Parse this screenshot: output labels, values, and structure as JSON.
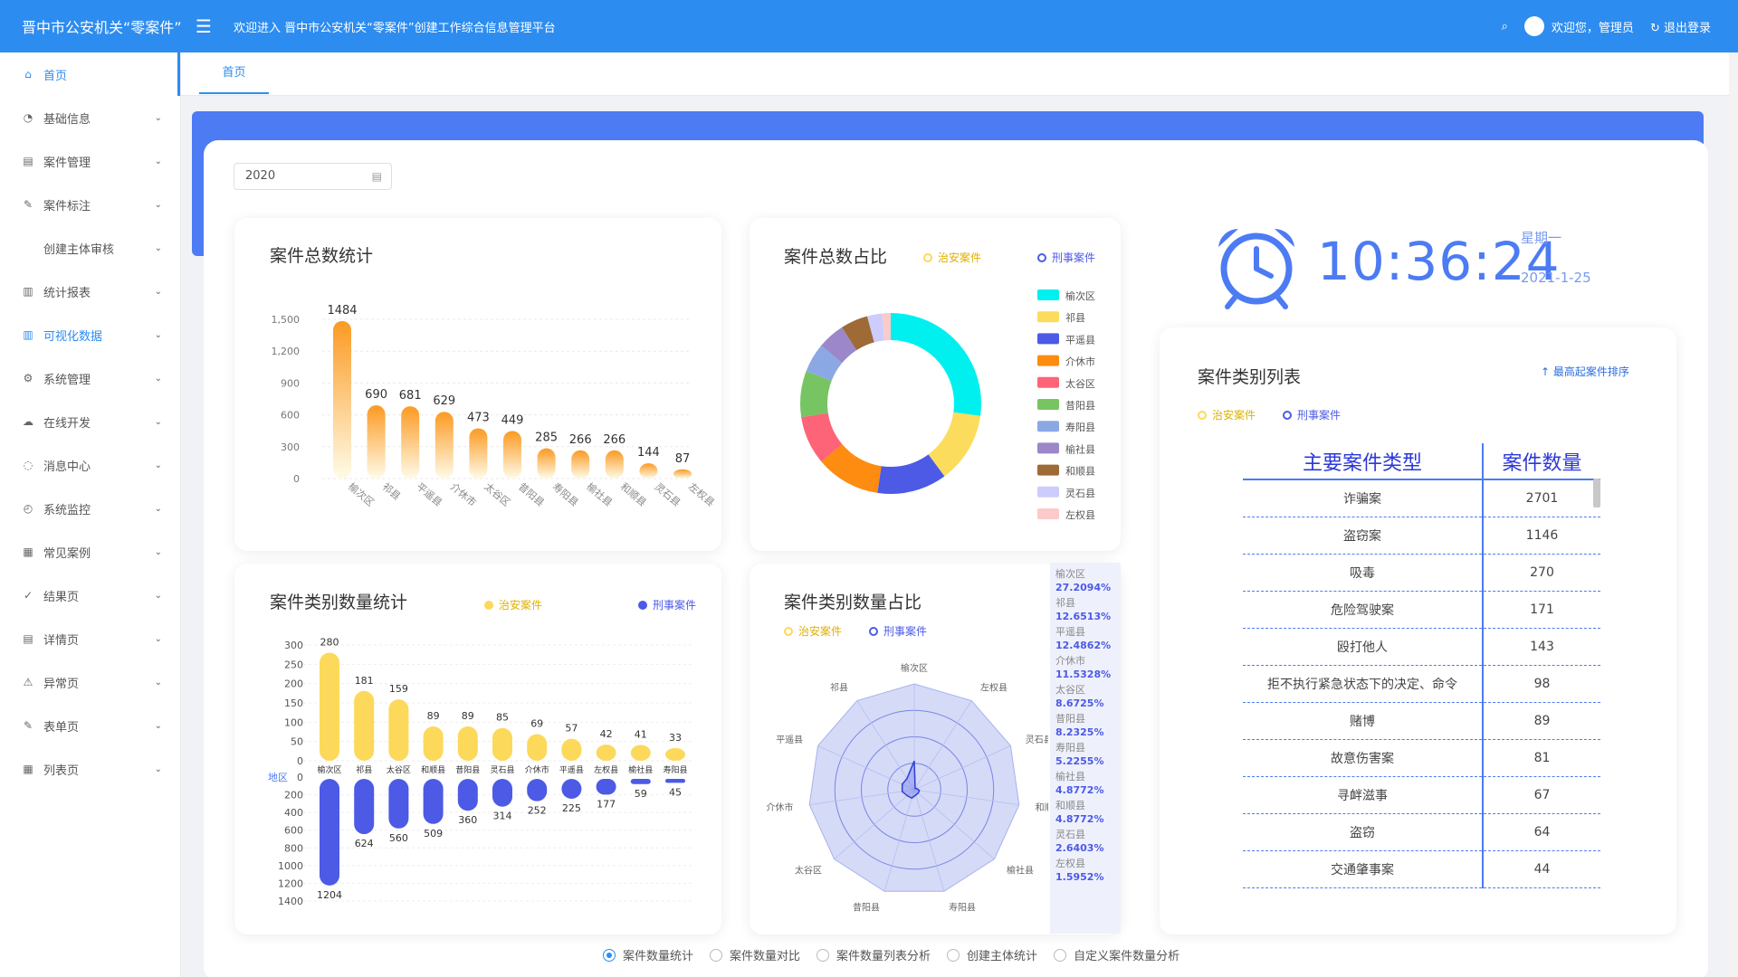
{
  "header": {
    "brand": "晋中市公安机关“零案件”",
    "welcome": "欢迎进入 晋中市公安机关“零案件”创建工作综合信息管理平台",
    "user": "欢迎您，管理员",
    "logout": "退出登录",
    "search_icon": "search-icon"
  },
  "sidebar": {
    "items": [
      {
        "label": "首页",
        "icon": "⌂"
      },
      {
        "label": "基础信息",
        "icon": "◔"
      },
      {
        "label": "案件管理",
        "icon": "▤"
      },
      {
        "label": "案件标注",
        "icon": "✎"
      },
      {
        "label": "创建主体审核",
        "icon": ""
      },
      {
        "label": "统计报表",
        "icon": "▥"
      },
      {
        "label": "可视化数据",
        "icon": "▥"
      },
      {
        "label": "系统管理",
        "icon": "⚙"
      },
      {
        "label": "在线开发",
        "icon": "☁"
      },
      {
        "label": "消息中心",
        "icon": "◌"
      },
      {
        "label": "系统监控",
        "icon": "◴"
      },
      {
        "label": "常见案例",
        "icon": "▦"
      },
      {
        "label": "结果页",
        "icon": "✓"
      },
      {
        "label": "详情页",
        "icon": "▤"
      },
      {
        "label": "异常页",
        "icon": "⚠"
      },
      {
        "label": "表单页",
        "icon": "✎"
      },
      {
        "label": "列表页",
        "icon": "▦"
      }
    ]
  },
  "tabs": {
    "home": "首页"
  },
  "filters": {
    "year": "2020"
  },
  "colors": {
    "primary": "#2d8cf0",
    "band": "#4c7bf3",
    "zhian": "#fcd95a",
    "xingshi": "#4c5ae6"
  },
  "legend": {
    "zhian": "治安案件",
    "xingshi": "刑事案件"
  },
  "cards": {
    "total": {
      "title": "案件总数统计"
    },
    "share": {
      "title": "案件总数占比"
    },
    "category": {
      "title": "案件类别数量统计",
      "x_axis_name": "地区"
    },
    "category_share": {
      "title": "案件类别数量占比"
    },
    "list": {
      "title": "案件类别列表",
      "sort_label": "↑ 最高起案件排序",
      "col1": "主要案件类型",
      "col2": "案件数量"
    }
  },
  "clock": {
    "time": "10:36:24",
    "weekday": "星期一",
    "date": "2021-1-25"
  },
  "chart_data": [
    {
      "type": "bar",
      "title": "案件总数统计",
      "categories": [
        "榆次区",
        "祁县",
        "平遥县",
        "介休市",
        "太谷区",
        "昔阳县",
        "寿阳县",
        "榆社县",
        "和顺县",
        "灵石县",
        "左权县"
      ],
      "values": [
        1484,
        690,
        681,
        629,
        473,
        449,
        285,
        266,
        266,
        144,
        87
      ],
      "ylim": [
        0,
        1500
      ],
      "yticks": [
        "0",
        "300",
        "600",
        "900",
        "1,200",
        "1,500"
      ]
    },
    {
      "type": "pie",
      "title": "案件总数占比",
      "labels": [
        "榆次区",
        "祁县",
        "平遥县",
        "介休市",
        "太谷区",
        "昔阳县",
        "寿阳县",
        "榆社县",
        "和顺县",
        "灵石县",
        "左权县"
      ],
      "values": [
        1484,
        690,
        681,
        629,
        473,
        449,
        285,
        266,
        266,
        144,
        87
      ],
      "colors": [
        "#00f0f0",
        "#fcdc5c",
        "#4c5ae6",
        "#fd8c10",
        "#fd6478",
        "#77c463",
        "#8ca8e4",
        "#9b87c9",
        "#9e6a36",
        "#cccdfd",
        "#fccaca"
      ]
    },
    {
      "type": "bar",
      "title": "案件类别数量统计",
      "xlabel": "地区",
      "categories": [
        "榆次区",
        "祁县",
        "太谷区",
        "和顺县",
        "昔阳县",
        "灵石县",
        "介休市",
        "平遥县",
        "左权县",
        "榆社县",
        "寿阳县"
      ],
      "series": [
        {
          "name": "治安案件",
          "values": [
            280,
            181,
            159,
            89,
            89,
            85,
            69,
            57,
            42,
            41,
            33
          ]
        },
        {
          "name": "刑事案件",
          "values": [
            1204,
            624,
            560,
            509,
            360,
            314,
            252,
            225,
            177,
            59,
            45
          ]
        }
      ],
      "upper_ticks": [
        "0",
        "50",
        "100",
        "150",
        "200",
        "250",
        "300"
      ],
      "lower_ticks": [
        "0",
        "200",
        "400",
        "600",
        "800",
        "1000",
        "1200",
        "1400"
      ]
    },
    {
      "type": "radar",
      "title": "案件类别数量占比",
      "axes": [
        "榆次区",
        "左权县",
        "灵石县",
        "和顺县",
        "榆社县",
        "寿阳县",
        "昔阳县",
        "太谷区",
        "介休市",
        "平遥县",
        "祁县"
      ],
      "ratios": [
        {
          "name": "榆次区",
          "value": "27.2094%"
        },
        {
          "name": "祁县",
          "value": "12.6513%"
        },
        {
          "name": "平遥县",
          "value": "12.4862%"
        },
        {
          "name": "介休市",
          "value": "11.5328%"
        },
        {
          "name": "太谷区",
          "value": "8.6725%"
        },
        {
          "name": "昔阳县",
          "value": "8.2325%"
        },
        {
          "name": "寿阳县",
          "value": "5.2255%"
        },
        {
          "name": "榆社县",
          "value": "4.8772%"
        },
        {
          "name": "和顺县",
          "value": "4.8772%"
        },
        {
          "name": "灵石县",
          "value": "2.6403%"
        },
        {
          "name": "左权县",
          "value": "1.5952%"
        }
      ]
    },
    {
      "type": "table",
      "title": "案件类别列表",
      "columns": [
        "主要案件类型",
        "案件数量"
      ],
      "rows": [
        [
          "诈骗案",
          "2701"
        ],
        [
          "盗窃案",
          "1146"
        ],
        [
          "吸毒",
          "270"
        ],
        [
          "危险驾驶案",
          "171"
        ],
        [
          "殴打他人",
          "143"
        ],
        [
          "拒不执行紧急状态下的决定、命令",
          "98"
        ],
        [
          "赌博",
          "89"
        ],
        [
          "故意伤害案",
          "81"
        ],
        [
          "寻衅滋事",
          "67"
        ],
        [
          "盗窃",
          "64"
        ],
        [
          "交通肇事案",
          "44"
        ]
      ]
    }
  ],
  "bottom_radios": [
    {
      "label": "案件数量统计",
      "checked": true
    },
    {
      "label": "案件数量对比",
      "checked": false
    },
    {
      "label": "案件数量列表分析",
      "checked": false
    },
    {
      "label": "创建主体统计",
      "checked": false
    },
    {
      "label": "自定义案件数量分析",
      "checked": false
    }
  ]
}
